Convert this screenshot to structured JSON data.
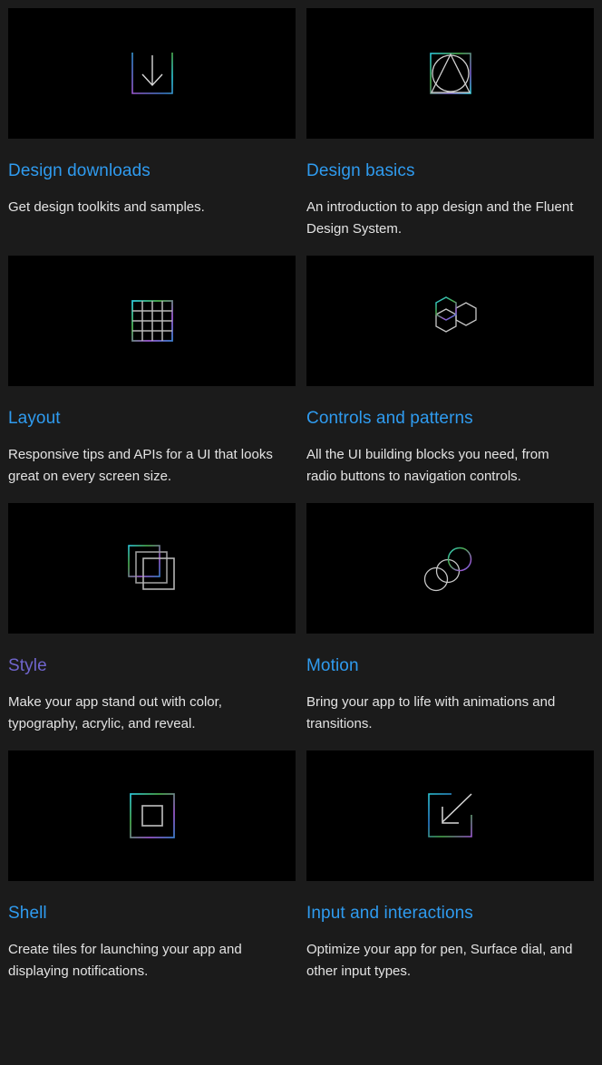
{
  "page": {
    "background_color": "#1b1b1b",
    "thumb_background_color": "#000000",
    "link_color": "#2f9bef",
    "visited_link_color": "#7065cd",
    "body_text_color": "#e3e3e3",
    "gradient": {
      "start": "#2ec9d9",
      "mid": "#4caf50",
      "end": "#9b59d0"
    }
  },
  "cards": [
    {
      "icon": "download-arrow-in-box-icon",
      "title": "Design downloads",
      "description": "Get design toolkits and samples.",
      "visited": false
    },
    {
      "icon": "circle-triangle-square-icon",
      "title": "Design basics",
      "description": "An introduction to app design and the Fluent Design System.",
      "visited": false
    },
    {
      "icon": "grid-icon",
      "title": "Layout",
      "description": "Responsive tips and APIs for a UI that looks great on every screen size.",
      "visited": false
    },
    {
      "icon": "hexagons-icon",
      "title": "Controls and patterns",
      "description": "All the UI building blocks you need, from radio buttons to navigation controls.",
      "visited": false
    },
    {
      "icon": "stacked-squares-icon",
      "title": "Style",
      "description": "Make your app stand out with color, typography, acrylic, and reveal.",
      "visited": true
    },
    {
      "icon": "overlapping-circles-icon",
      "title": "Motion",
      "description": "Bring your app to life with animations and transitions.",
      "visited": false
    },
    {
      "icon": "square-in-square-icon",
      "title": "Shell",
      "description": "Create tiles for launching your app and displaying notifications.",
      "visited": false
    },
    {
      "icon": "arrow-into-corner-icon",
      "title": "Input and interactions",
      "description": "Optimize your app for pen, Surface dial, and other input types.",
      "visited": false
    }
  ]
}
